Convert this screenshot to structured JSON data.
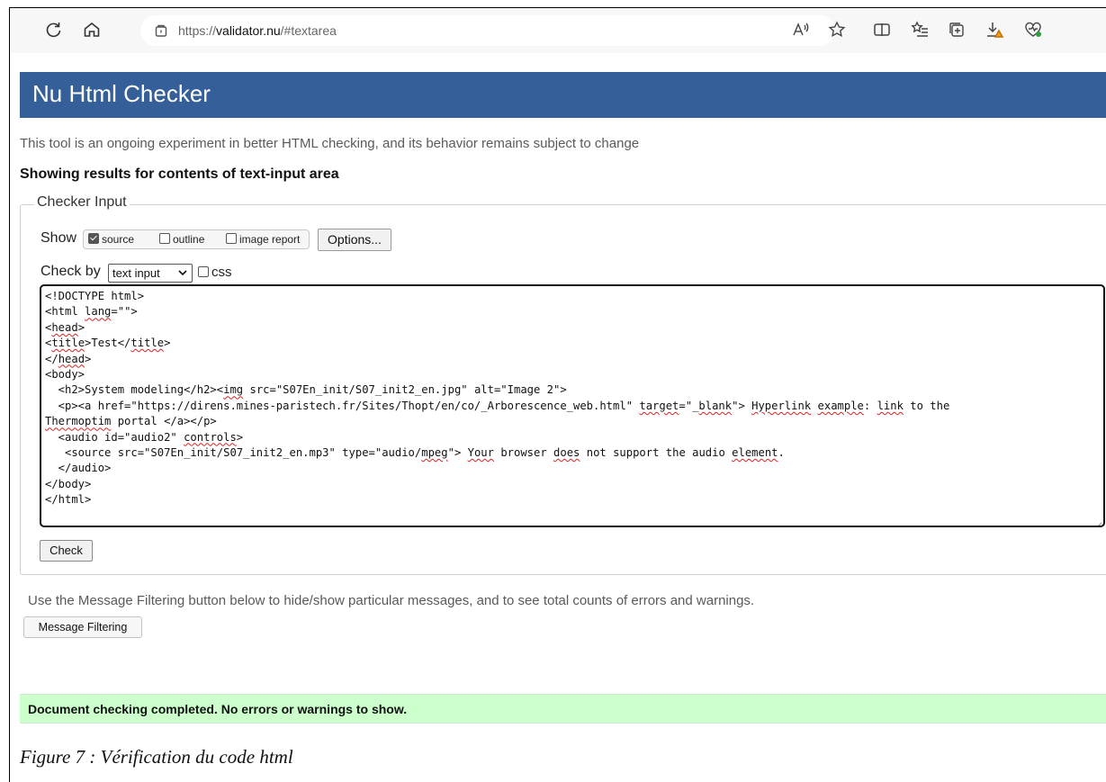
{
  "browser": {
    "url_prefix": "https://",
    "url_host": "validator.nu",
    "url_path": "/#textarea"
  },
  "header": {
    "title": "Nu Html Checker"
  },
  "intro_text": "This tool is an ongoing experiment in better HTML checking, and its behavior remains subject to change",
  "results_heading": "Showing results for contents of text-input area",
  "checker_input": {
    "legend": "Checker Input",
    "show_label": "Show",
    "options": [
      {
        "label": "source",
        "checked": true
      },
      {
        "label": "outline",
        "checked": false
      },
      {
        "label": "image report",
        "checked": false
      }
    ],
    "options_button": "Options...",
    "check_by_label": "Check by",
    "check_by_value": "text input",
    "css_label": "css",
    "check_button": "Check"
  },
  "source_lines": [
    [
      {
        "t": "<!DOCTYPE html>"
      }
    ],
    [
      {
        "t": "<html "
      },
      {
        "t": "lang",
        "sq": true
      },
      {
        "t": "=\"\">"
      }
    ],
    [
      {
        "t": "<"
      },
      {
        "t": "head",
        "sq": true
      },
      {
        "t": ">"
      }
    ],
    [
      {
        "t": "<"
      },
      {
        "t": "title",
        "sq": true
      },
      {
        "t": ">Test</"
      },
      {
        "t": "title",
        "sq": true
      },
      {
        "t": ">"
      }
    ],
    [
      {
        "t": "</"
      },
      {
        "t": "head",
        "sq": true
      },
      {
        "t": ">"
      }
    ],
    [
      {
        "t": "<body>"
      }
    ],
    [
      {
        "t": "  <h2>System modeling</h2><"
      },
      {
        "t": "img",
        "sq": true
      },
      {
        "t": " src=\"S07En_init/S07_init2_en.jpg\" alt=\"Image 2\">"
      }
    ],
    [
      {
        "t": "  <p><a href=\"https://direns.mines-paristech.fr/Sites/Thopt/en/co/_Arborescence_web.html\" "
      },
      {
        "t": "target",
        "sq": true
      },
      {
        "t": "=\"_"
      },
      {
        "t": "blank",
        "sq": true
      },
      {
        "t": "\"> "
      },
      {
        "t": "Hyperlink",
        "sq": true
      },
      {
        "t": " "
      },
      {
        "t": "example",
        "sq": true
      },
      {
        "t": ": "
      },
      {
        "t": "link",
        "sq": true
      },
      {
        "t": " to the"
      }
    ],
    [
      {
        "t": "Thermoptim",
        "sq": true
      },
      {
        "t": " portal </a></p>"
      }
    ],
    [
      {
        "t": "  <audio id=\"audio2\" "
      },
      {
        "t": "controls",
        "sq": true
      },
      {
        "t": ">"
      }
    ],
    [
      {
        "t": "   <source src=\"S07En_init/S07_init2_en.mp3\" type=\"audio/"
      },
      {
        "t": "mpeg",
        "sq": true
      },
      {
        "t": "\"> "
      },
      {
        "t": "Your",
        "sq": true
      },
      {
        "t": " browser "
      },
      {
        "t": "does",
        "sq": true
      },
      {
        "t": " not support the audio "
      },
      {
        "t": "element",
        "sq": true
      },
      {
        "t": "."
      }
    ],
    [
      {
        "t": "  </audio>"
      }
    ],
    [
      {
        "t": "</body>"
      }
    ],
    [
      {
        "t": "</html>"
      }
    ]
  ],
  "filter_note": "Use the Message Filtering button below to hide/show particular messages, and to see total counts of errors and warnings.",
  "filter_button": "Message Filtering",
  "success_message": "Document checking completed. No errors or warnings to show.",
  "caption": "Figure 7 : Vérification du code html"
}
